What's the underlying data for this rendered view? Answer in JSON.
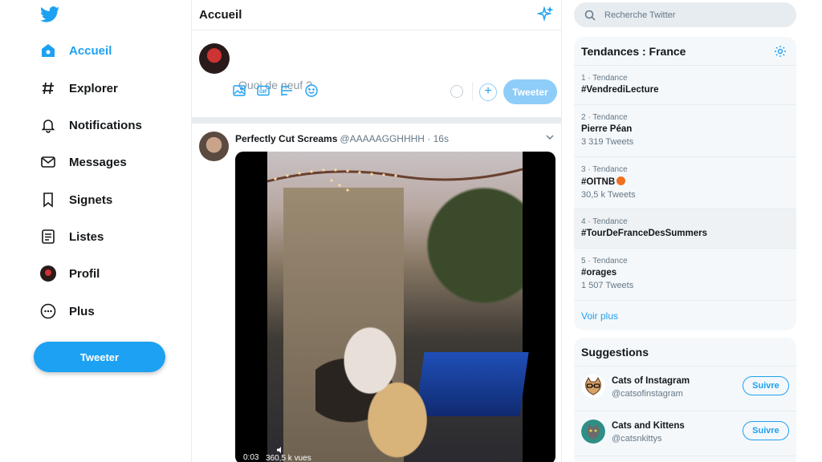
{
  "nav": {
    "items": [
      {
        "label": "Accueil",
        "icon": "home-icon",
        "active": true
      },
      {
        "label": "Explorer",
        "icon": "hashtag-icon"
      },
      {
        "label": "Notifications",
        "icon": "bell-icon"
      },
      {
        "label": "Messages",
        "icon": "envelope-icon"
      },
      {
        "label": "Signets",
        "icon": "bookmark-icon"
      },
      {
        "label": "Listes",
        "icon": "list-icon"
      },
      {
        "label": "Profil",
        "icon": "avatar-icon"
      },
      {
        "label": "Plus",
        "icon": "more-icon"
      }
    ],
    "tweet_button": "Tweeter"
  },
  "header": {
    "title": "Accueil"
  },
  "composer": {
    "placeholder": "Quoi de neuf ?",
    "tweet_button": "Tweeter",
    "add_symbol": "+"
  },
  "tweet": {
    "name": "Perfectly Cut Screams",
    "handle": "@AAAAAGGHHHH · 16s",
    "video_time": "0:03",
    "views": "360,5 k vues"
  },
  "search": {
    "placeholder": "Recherche Twitter"
  },
  "trends": {
    "title": "Tendances : France",
    "items": [
      {
        "meta": "1 · Tendance",
        "name": "#VendrediLecture",
        "count": ""
      },
      {
        "meta": "2 · Tendance",
        "name": "Pierre Péan",
        "count": "3 319 Tweets"
      },
      {
        "meta": "3 · Tendance",
        "name": "#OITNB",
        "count": "30,5 k Tweets"
      },
      {
        "meta": "4 · Tendance",
        "name": "#TourDeFranceDesSummers",
        "count": ""
      },
      {
        "meta": "5 · Tendance",
        "name": "#orages",
        "count": "1 507 Tweets"
      }
    ],
    "see_more": "Voir plus"
  },
  "suggestions": {
    "title": "Suggestions",
    "items": [
      {
        "name": "Cats of Instagram",
        "handle": "@catsofinstagram",
        "follow": "Suivre"
      },
      {
        "name": "Cats and Kittens",
        "handle": "@catsnkittys",
        "follow": "Suivre"
      }
    ]
  },
  "colors": {
    "accent": "#1da1f2",
    "accent_light": "#8ecdf8",
    "panel_bg": "#f5f8fa",
    "border": "#e6ecf0"
  }
}
